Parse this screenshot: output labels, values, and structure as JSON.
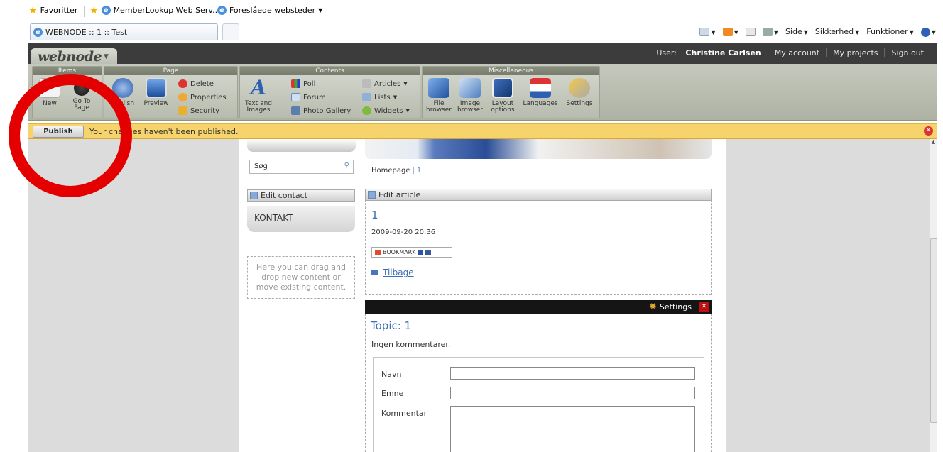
{
  "browser": {
    "favorites_label": "Favoritter",
    "fav_link_1": "MemberLookup Web Serv...",
    "fav_link_2": "Foreslåede websteder",
    "tab_title": "WEBNODE :: 1 :: Test",
    "cmd_page": "Side",
    "cmd_security": "Sikkerhed",
    "cmd_tools": "Funktioner"
  },
  "webnode": {
    "logo": "webnode",
    "user_label": "User:",
    "user_name": "Christine Carlsen",
    "my_account": "My account",
    "my_projects": "My projects",
    "sign_out": "Sign out"
  },
  "ribbon": {
    "items": {
      "title": "Items",
      "new": "New",
      "goto_1": "Go To",
      "goto_2": "Page"
    },
    "page": {
      "title": "Page",
      "publish": "Publish",
      "preview": "Preview",
      "delete": "Delete",
      "properties": "Properties",
      "security": "Security"
    },
    "contents": {
      "title": "Contents",
      "text_images_1": "Text and",
      "text_images_2": "Images",
      "poll": "Poll",
      "forum": "Forum",
      "photo_gallery": "Photo Gallery",
      "articles": "Articles",
      "lists": "Lists",
      "widgets": "Widgets"
    },
    "misc": {
      "title": "Miscellaneous",
      "file_1": "File",
      "file_2": "browser",
      "image_1": "Image",
      "image_2": "browser",
      "layout_1": "Layout",
      "layout_2": "options",
      "languages": "Languages",
      "settings": "Settings"
    }
  },
  "publish_bar": {
    "button": "Publish",
    "message": "Your changes haven't been published."
  },
  "left_col": {
    "search_placeholder": "Søg",
    "edit_contact": "Edit contact",
    "kontakt": "KONTAKT",
    "dropzone": "Here you can drag and drop new content or move existing content."
  },
  "main": {
    "breadcrumb_home": "Homepage",
    "breadcrumb_current": "1",
    "edit_article": "Edit article",
    "article_title": "1",
    "article_date": "2009-09-20 20:36",
    "bookmark": "BOOKMARK",
    "back_link": "Tilbage",
    "settings": "Settings",
    "topic_title": "Topic: 1",
    "no_comments": "Ingen kommentarer.",
    "label_name": "Navn",
    "label_subject": "Emne",
    "label_comment": "Kommentar"
  },
  "colors": {
    "publish_bar": "#f6d36b",
    "annotation_circle": "#e40000",
    "link": "#3c6fb3"
  }
}
